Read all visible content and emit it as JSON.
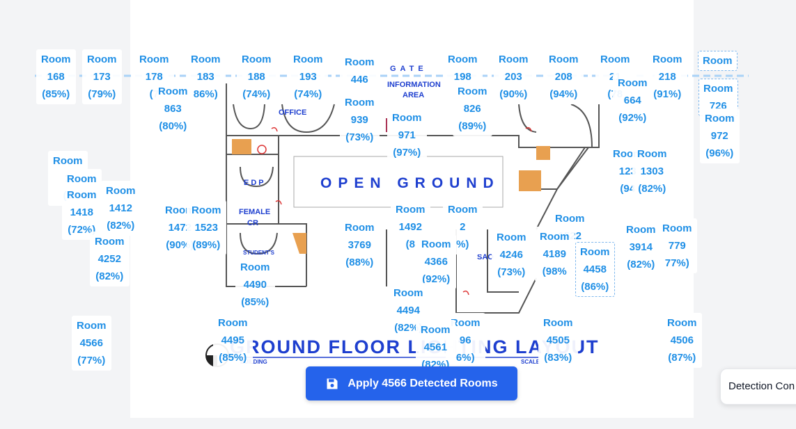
{
  "plan": {
    "open_ground": "OPEN GROUND",
    "floor_title": "GROUND FLOOR LIGHTING LAYOUT",
    "gate": "GATE",
    "information_area_1": "INFORMATION",
    "information_area_2": "AREA",
    "office": "OFFICE",
    "edp": "EDP",
    "female_cr_1": "FEMALE",
    "female_cr_2": "CR",
    "students": "STUDENT'S",
    "sao": "SAO",
    "building": "BUILDING",
    "scale": "SCALE"
  },
  "room_word": "Room",
  "rooms": [
    {
      "id": "168",
      "conf": "(85%)"
    },
    {
      "id": "173",
      "conf": "(79%)"
    },
    {
      "id": "178",
      "conf": "(7"
    },
    {
      "id": "183",
      "conf": "86%)"
    },
    {
      "id": "188",
      "conf": "(74%)"
    },
    {
      "id": "193",
      "conf": "(74%)"
    },
    {
      "id": "446",
      "conf": ""
    },
    {
      "id": "198",
      "conf": ""
    },
    {
      "id": "203",
      "conf": "(90%)"
    },
    {
      "id": "208",
      "conf": "(94%)"
    },
    {
      "id": "21",
      "conf": "(78"
    },
    {
      "id": "218",
      "conf": "(91%)"
    },
    {
      "id": "",
      "conf": ""
    },
    {
      "id": "726",
      "conf": ""
    },
    {
      "id": "863",
      "conf": "(80%)"
    },
    {
      "id": "939",
      "conf": "(73%)"
    },
    {
      "id": "971",
      "conf": "(97%)"
    },
    {
      "id": "826",
      "conf": "(89%)"
    },
    {
      "id": "664",
      "conf": "(92%)"
    },
    {
      "id": "972",
      "conf": "(96%)"
    },
    {
      "id": "1",
      "conf": "(9"
    },
    {
      "id": "",
      "conf": ""
    },
    {
      "id": "1418",
      "conf": "(72%)"
    },
    {
      "id": "1412",
      "conf": "(82%)"
    },
    {
      "id": "1472",
      "conf": "(90%)"
    },
    {
      "id": "1523",
      "conf": "(89%)"
    },
    {
      "id": "1492",
      "conf": "(8"
    },
    {
      "id": "2",
      "conf": "%)"
    },
    {
      "id": "1522",
      "conf": ""
    },
    {
      "id": "123",
      "conf": "(94"
    },
    {
      "id": "1303",
      "conf": "(82%)"
    },
    {
      "id": "3769",
      "conf": "(88%)"
    },
    {
      "id": "4252",
      "conf": "(82%)"
    },
    {
      "id": "4490",
      "conf": "(85%)"
    },
    {
      "id": "4366",
      "conf": "(92%)"
    },
    {
      "id": "4246",
      "conf": "(73%)"
    },
    {
      "id": "4189",
      "conf": "(98%"
    },
    {
      "id": "4458",
      "conf": "(86%)"
    },
    {
      "id": "3914",
      "conf": "(82%)"
    },
    {
      "id": "779",
      "conf": "77%)"
    },
    {
      "id": "4494",
      "conf": "(82%)"
    },
    {
      "id": "4495",
      "conf": "(85%)"
    },
    {
      "id": "96",
      "conf": "6%)"
    },
    {
      "id": "4505",
      "conf": "(83%)"
    },
    {
      "id": "4506",
      "conf": "(87%)"
    },
    {
      "id": "4561",
      "conf": "(82%)"
    },
    {
      "id": "4566",
      "conf": "(77%)"
    }
  ],
  "apply_button": {
    "label": "Apply 4566 Detected Rooms",
    "icon": "save-icon"
  },
  "detection_panel": {
    "label": "Detection Con"
  },
  "colors": {
    "accent": "#2563eb",
    "label_text": "#1f8fe6",
    "plan_ink": "#1e3fcf"
  }
}
